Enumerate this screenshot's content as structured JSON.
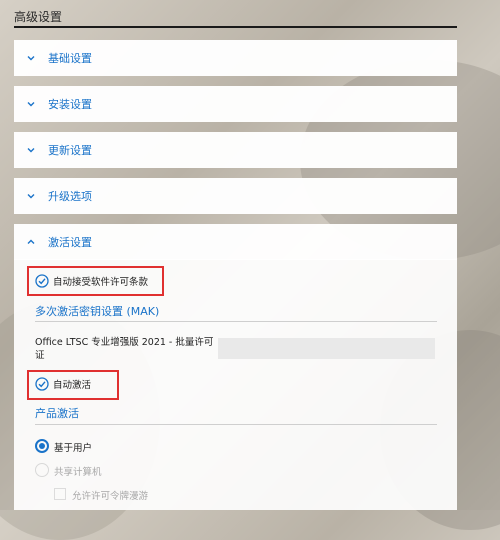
{
  "header": {
    "title": "高级设置"
  },
  "sections": [
    {
      "label": "基础设置"
    },
    {
      "label": "安装设置"
    },
    {
      "label": "更新设置"
    },
    {
      "label": "升级选项"
    },
    {
      "label": "激活设置"
    }
  ],
  "activation": {
    "auto_accept_label": "自动接受软件许可条款",
    "mak_heading": "多次激活密钥设置 (MAK)",
    "office_label": "Office LTSC 专业增强版 2021 - 批量许可证",
    "office_value": "",
    "auto_activate_label": "自动激活",
    "product_activation_heading": "产品激活",
    "radio_user_label": "基于用户",
    "radio_shared_label": "共享计算机",
    "allow_roaming_label": "允许许可令牌漫游"
  },
  "colors": {
    "accent": "#1a73c9",
    "highlight": "#e03030"
  }
}
